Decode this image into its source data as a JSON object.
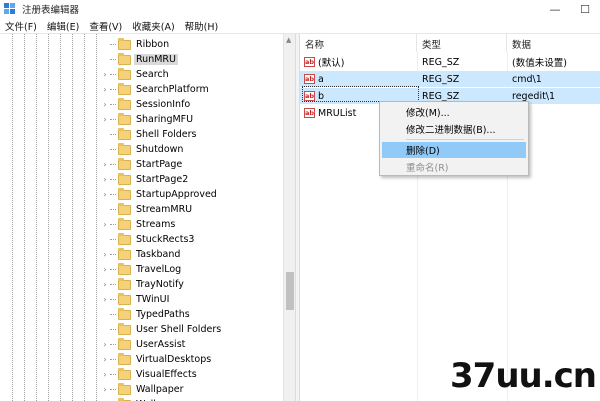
{
  "window": {
    "title": "注册表编辑器",
    "minimize": "—",
    "maximize": "☐"
  },
  "menu": [
    "文件(F)",
    "编辑(E)",
    "查看(V)",
    "收藏夹(A)",
    "帮助(H)"
  ],
  "tree": {
    "items": [
      {
        "label": "Ribbon",
        "expandable": false,
        "selected": false
      },
      {
        "label": "RunMRU",
        "expandable": false,
        "selected": true
      },
      {
        "label": "Search",
        "expandable": true,
        "selected": false
      },
      {
        "label": "SearchPlatform",
        "expandable": true,
        "selected": false
      },
      {
        "label": "SessionInfo",
        "expandable": true,
        "selected": false
      },
      {
        "label": "SharingMFU",
        "expandable": true,
        "selected": false
      },
      {
        "label": "Shell Folders",
        "expandable": false,
        "selected": false
      },
      {
        "label": "Shutdown",
        "expandable": false,
        "selected": false
      },
      {
        "label": "StartPage",
        "expandable": true,
        "selected": false
      },
      {
        "label": "StartPage2",
        "expandable": true,
        "selected": false
      },
      {
        "label": "StartupApproved",
        "expandable": true,
        "selected": false
      },
      {
        "label": "StreamMRU",
        "expandable": false,
        "selected": false
      },
      {
        "label": "Streams",
        "expandable": true,
        "selected": false
      },
      {
        "label": "StuckRects3",
        "expandable": false,
        "selected": false
      },
      {
        "label": "Taskband",
        "expandable": true,
        "selected": false
      },
      {
        "label": "TravelLog",
        "expandable": true,
        "selected": false
      },
      {
        "label": "TrayNotify",
        "expandable": true,
        "selected": false
      },
      {
        "label": "TWinUI",
        "expandable": true,
        "selected": false
      },
      {
        "label": "TypedPaths",
        "expandable": false,
        "selected": false
      },
      {
        "label": "User Shell Folders",
        "expandable": false,
        "selected": false
      },
      {
        "label": "UserAssist",
        "expandable": true,
        "selected": false
      },
      {
        "label": "VirtualDesktops",
        "expandable": true,
        "selected": false
      },
      {
        "label": "VisualEffects",
        "expandable": true,
        "selected": false
      },
      {
        "label": "Wallpaper",
        "expandable": true,
        "selected": false
      },
      {
        "label": "Wallpapers",
        "expandable": true,
        "selected": false
      }
    ]
  },
  "list": {
    "columns": [
      "名称",
      "类型",
      "数据"
    ],
    "rows": [
      {
        "name": "(默认)",
        "type": "REG_SZ",
        "data": "(数值未设置)",
        "icon": "ab",
        "state": "normal"
      },
      {
        "name": "a",
        "type": "REG_SZ",
        "data": "cmd\\1",
        "icon": "ab",
        "state": "selected"
      },
      {
        "name": "b",
        "type": "REG_SZ",
        "data": "regedit\\1",
        "icon": "ab",
        "state": "selected"
      },
      {
        "name": "MRUList",
        "type": "",
        "data": "",
        "icon": "ab",
        "state": "normal"
      }
    ]
  },
  "context_menu": {
    "items": [
      {
        "label": "修改(M)...",
        "state": "normal"
      },
      {
        "label": "修改二进制数据(B)...",
        "state": "normal"
      },
      {
        "label": "删除(D)",
        "state": "highlighted"
      },
      {
        "label": "重命名(R)",
        "state": "disabled"
      }
    ]
  },
  "watermark": "37uu.cn",
  "colors": {
    "selection": "#cce8ff",
    "menu_highlight": "#91c9f7",
    "folder": "#f3d27a"
  }
}
